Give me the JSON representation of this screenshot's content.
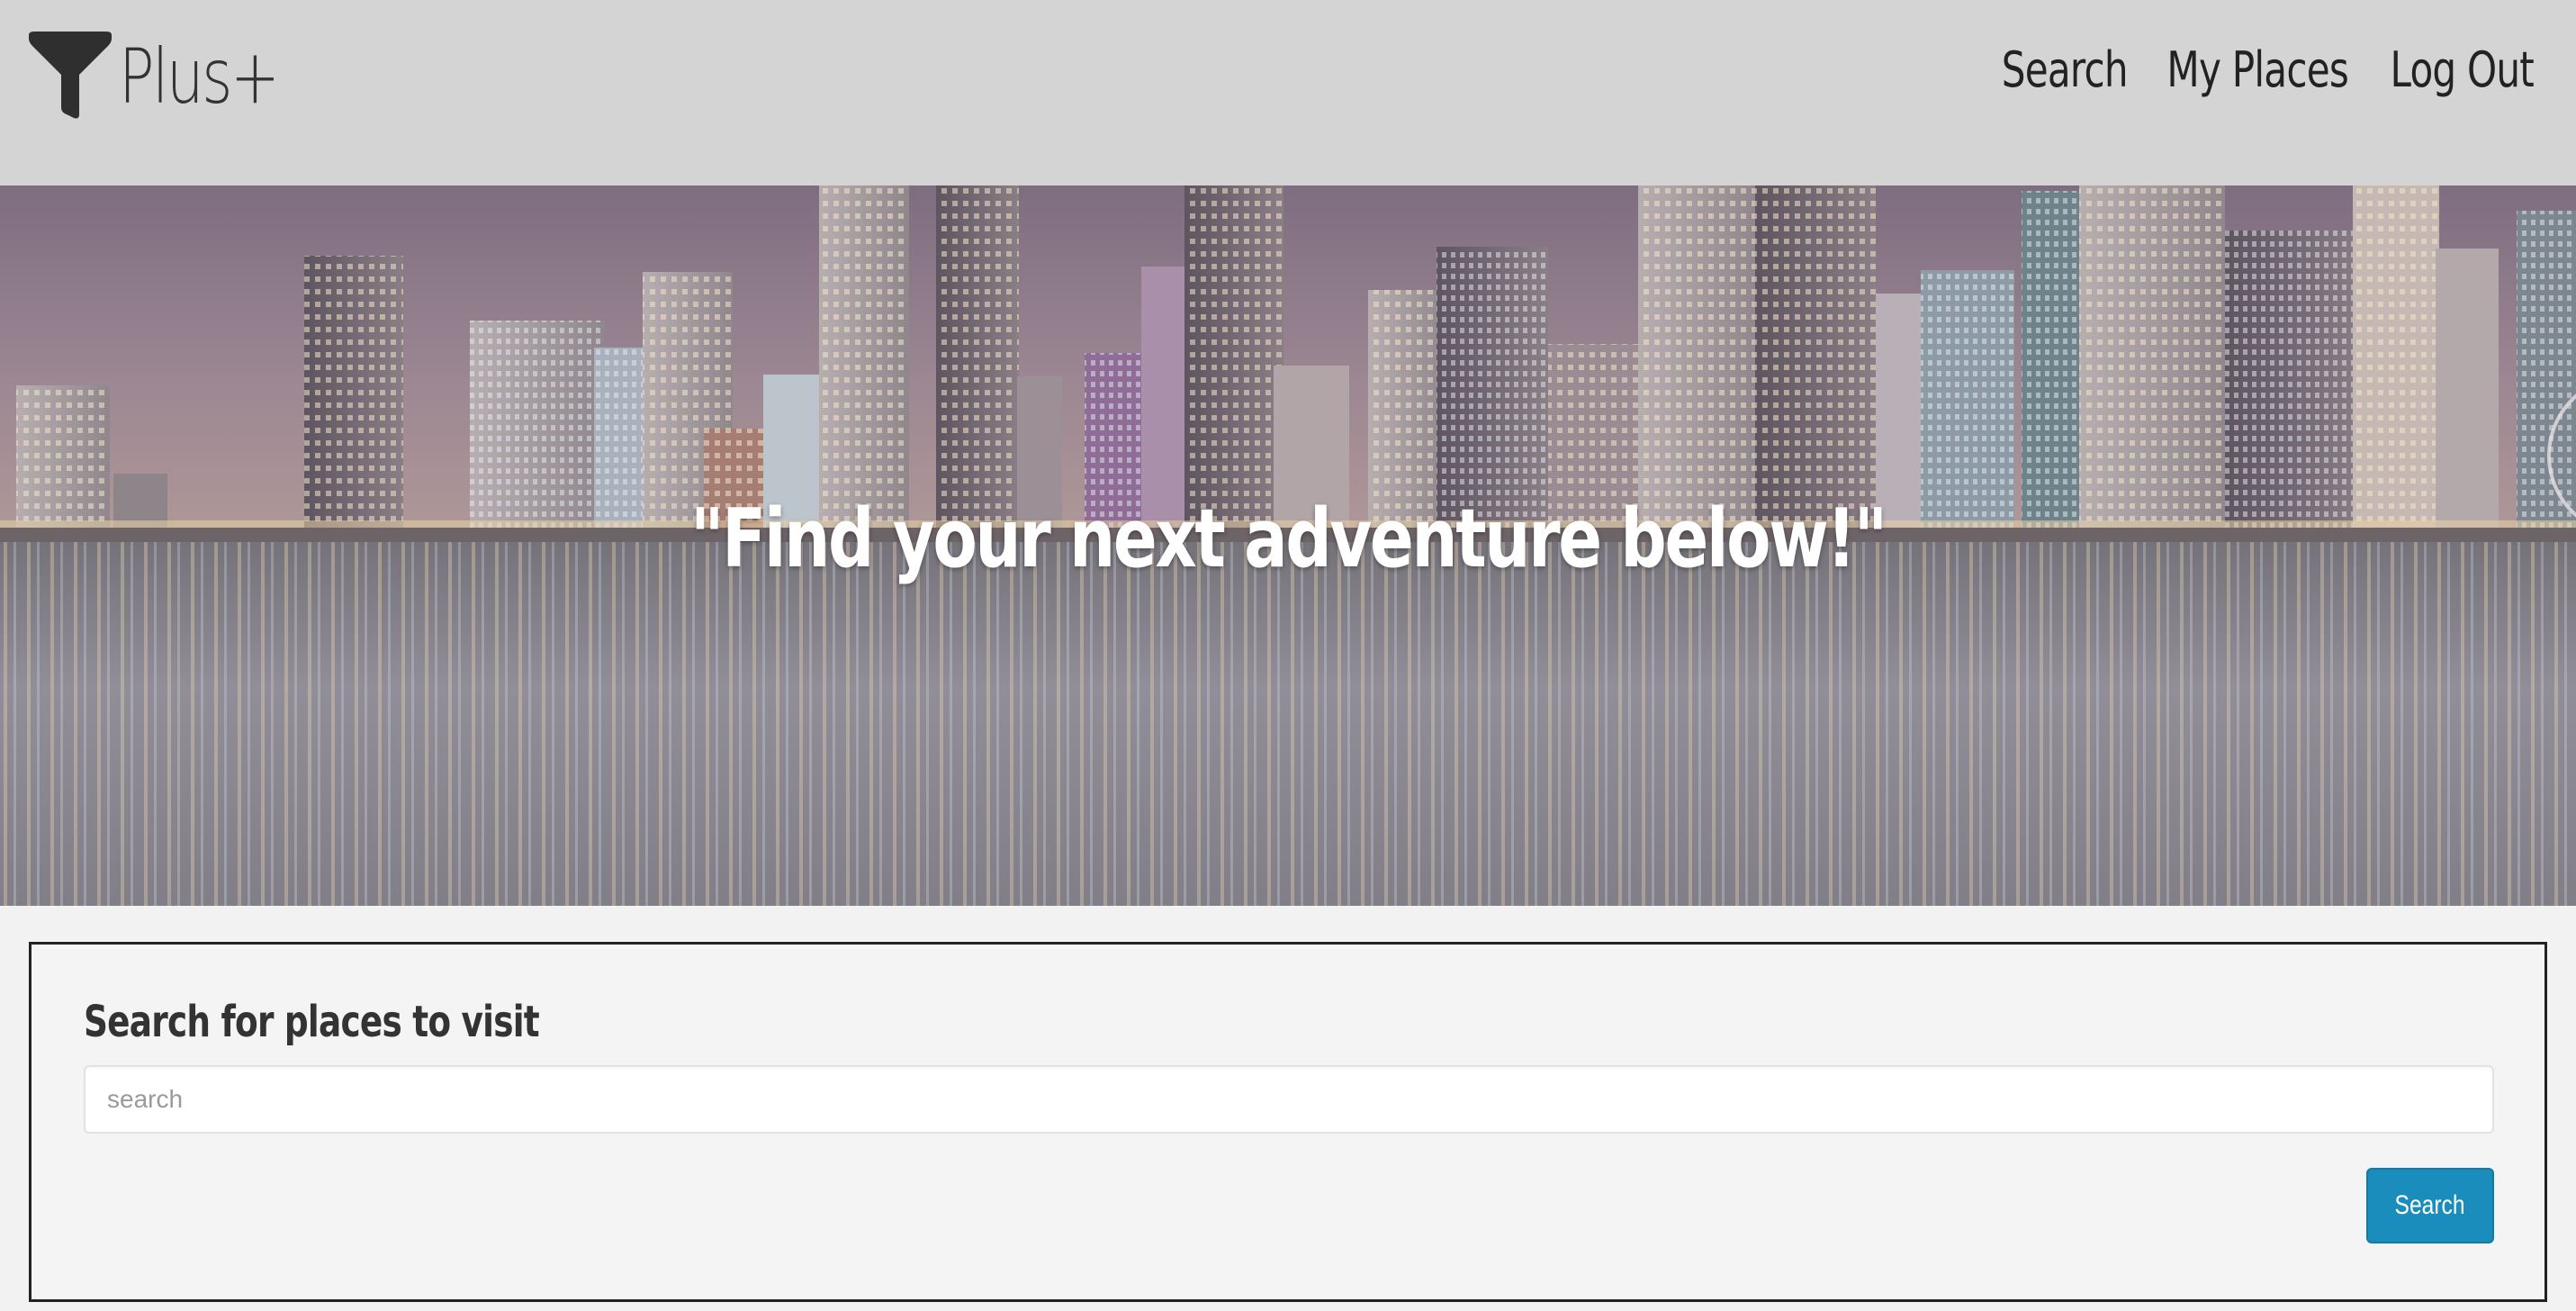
{
  "header": {
    "brand": {
      "name": "Plus+",
      "icon": "funnel-icon"
    },
    "nav": [
      {
        "label": "Search"
      },
      {
        "label": "My Places"
      },
      {
        "label": "Log Out"
      }
    ],
    "background_color": "#d4d4d4"
  },
  "hero": {
    "tagline": "\"Find your next adventure below!\"",
    "image": "city-skyline-at-night-reflected-in-water"
  },
  "search": {
    "heading": "Search for places to visit",
    "placeholder": "search",
    "value": "",
    "button_label": "Search",
    "button_color": "#1a8dbd"
  }
}
